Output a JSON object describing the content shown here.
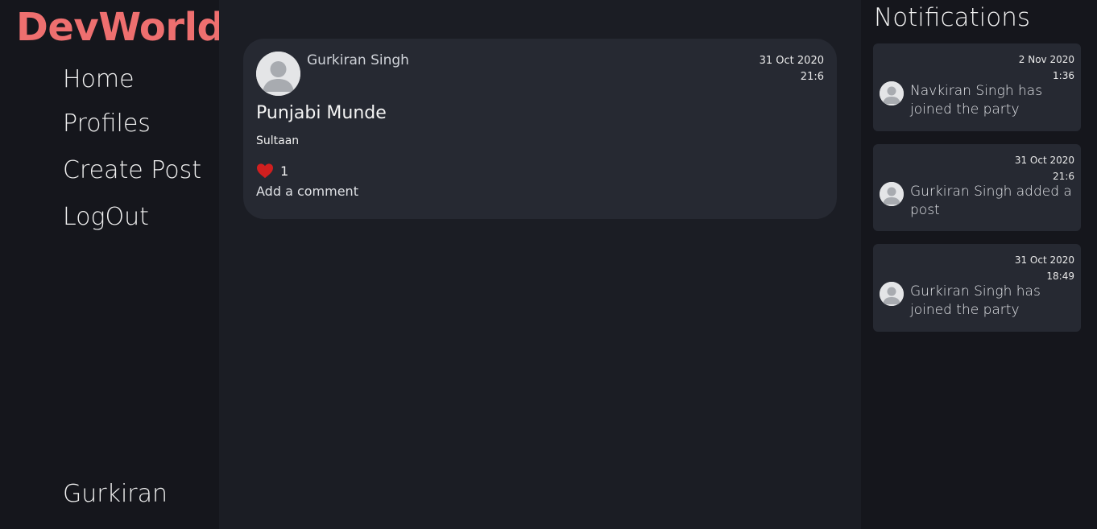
{
  "sidebar": {
    "brand": "DevWorld",
    "nav": {
      "home": "Home",
      "profiles": "Profiles",
      "create_post": "Create Post",
      "logout": "LogOut"
    },
    "current_user": "Gurkiran"
  },
  "feed": {
    "posts": [
      {
        "author": "Gurkiran Singh",
        "date": "31 Oct 2020",
        "time": "21:6",
        "title": "Punjabi Munde",
        "body": "Sultaan",
        "likes": "1",
        "add_comment": "Add a comment",
        "avatar_icon": "user-avatar-icon",
        "like_icon": "heart-icon"
      }
    ]
  },
  "notifications": {
    "heading": "Notifications",
    "items": [
      {
        "date": "2 Nov 2020",
        "time": "1:36",
        "text": "Navkiran Singh has joined the party",
        "avatar_icon": "user-avatar-icon"
      },
      {
        "date": "31 Oct 2020",
        "time": "21:6",
        "text": "Gurkiran Singh added a post",
        "avatar_icon": "user-avatar-icon"
      },
      {
        "date": "31 Oct 2020",
        "time": "18:49",
        "text": "Gurkiran Singh has joined the party",
        "avatar_icon": "user-avatar-icon"
      }
    ]
  },
  "colors": {
    "background": "#1b1d24",
    "sidebar": "#15161c",
    "card": "#262932",
    "brand": "#ee6f6f",
    "heart": "#d11f1f"
  }
}
